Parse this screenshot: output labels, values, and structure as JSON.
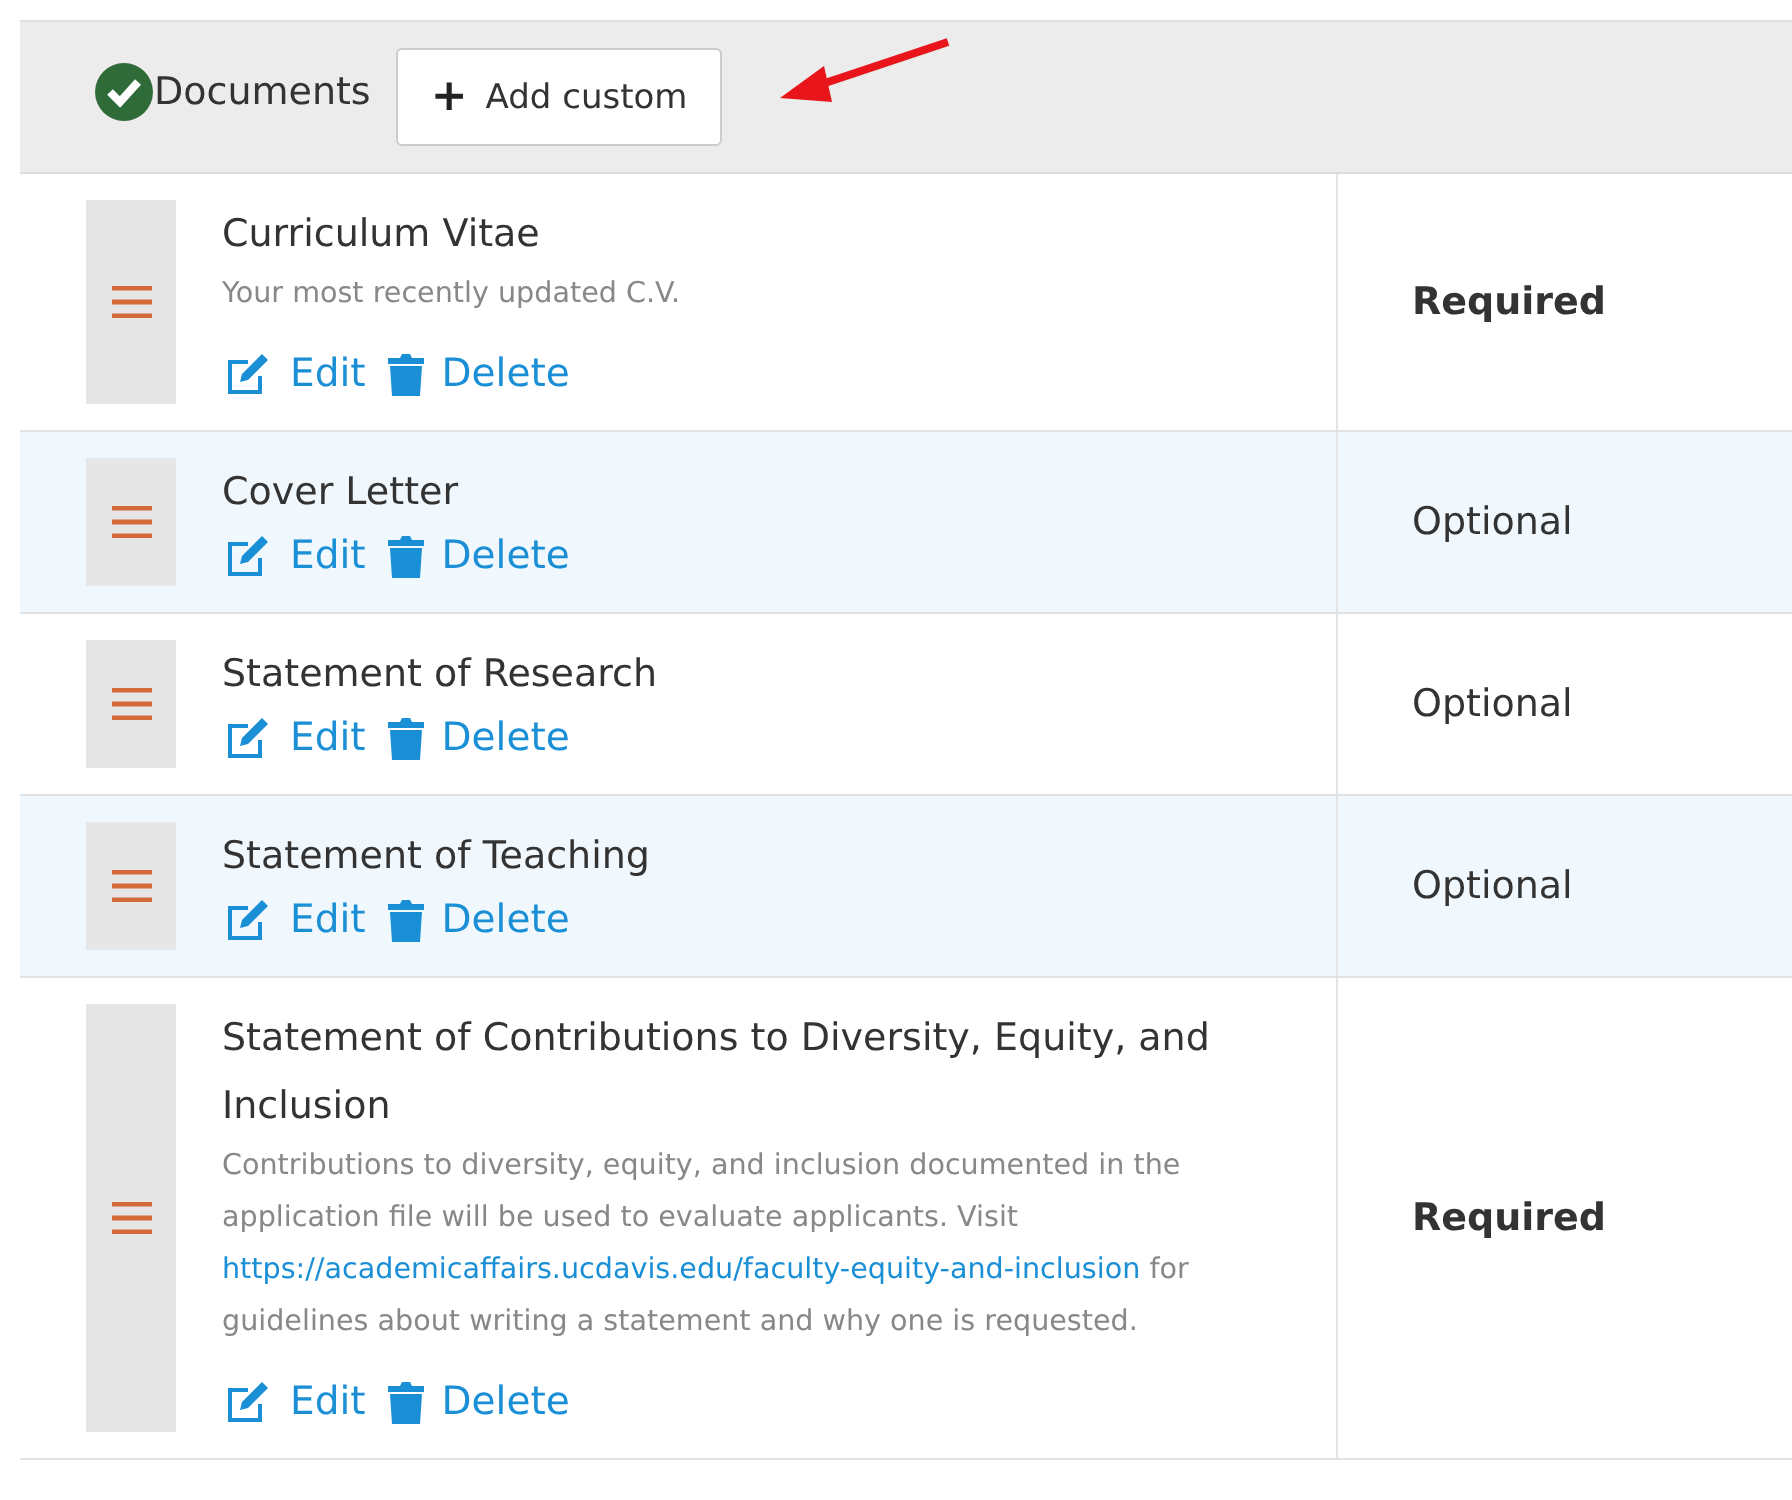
{
  "header": {
    "title": "Documents",
    "add_button": {
      "icon": "+",
      "label": "Add custom"
    }
  },
  "documents": [
    {
      "title": "Curriculum Vitae",
      "description": [
        {
          "text": "Your most recently updated C.V."
        }
      ],
      "actions": [
        "Edit",
        "Delete"
      ],
      "requirement": "Required",
      "kind": "required"
    },
    {
      "title": "Cover Letter",
      "actions": [
        "Edit",
        "Delete"
      ],
      "requirement": "Optional",
      "kind": "optional"
    },
    {
      "title": "Statement of Research",
      "actions": [
        "Edit",
        "Delete"
      ],
      "requirement": "Optional",
      "kind": "optional"
    },
    {
      "title": "Statement of Teaching",
      "actions": [
        "Edit",
        "Delete"
      ],
      "requirement": "Optional",
      "kind": "optional"
    },
    {
      "title": "Statement of Contributions to Diversity, Equity, and Inclusion",
      "description": [
        {
          "text": "Contributions to diversity, equity, and inclusion documented in the application file will be used to evaluate applicants. Visit "
        },
        {
          "text": "https://academicaffairs.ucdavis.edu/faculty-equity-and-inclusion",
          "kind": "link"
        },
        {
          "text": " for guidelines about writing a statement and why one is requested."
        }
      ],
      "actions": [
        "Edit",
        "Delete"
      ],
      "requirement": "Required",
      "kind": "required"
    }
  ]
}
